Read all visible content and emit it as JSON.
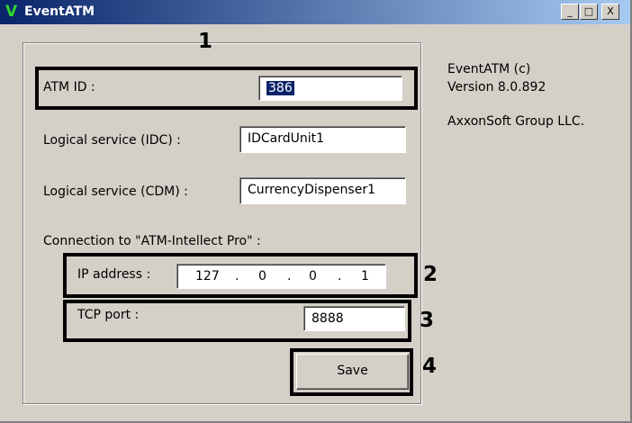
{
  "window": {
    "icon_glyph": "V",
    "title": "EventATM",
    "min_label": "_",
    "max_label": "□",
    "close_label": "X"
  },
  "form": {
    "atm_id_label": "ATM ID :",
    "atm_id_value": "386",
    "idc_label": "Logical service (IDC) :",
    "idc_value": "IDCardUnit1",
    "cdm_label": "Logical service (CDM) :",
    "cdm_value": "CurrencyDispenser1",
    "connection_label": "Connection to \"ATM-Intellect Pro\" :",
    "ip_label": "IP address :",
    "ip_octets": [
      "127",
      "0",
      "0",
      "1"
    ],
    "ip_dot": ".",
    "tcp_label": "TCP port :",
    "tcp_value": "8888",
    "save_label": "Save"
  },
  "info": {
    "line1": "EventATM (c)",
    "line2": "Version 8.0.892",
    "company": "AxxonSoft Group LLC."
  },
  "callouts": [
    "1",
    "2",
    "3",
    "4"
  ]
}
